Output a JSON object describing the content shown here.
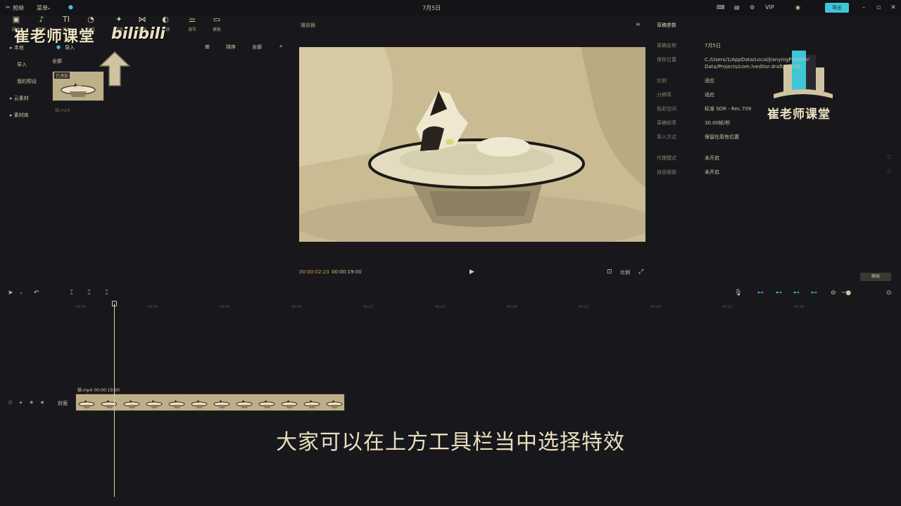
{
  "titlebar": {
    "app_name": "剪映",
    "menu": "菜单",
    "center_title": "7月5日",
    "export": "导出"
  },
  "toolbar": {
    "tools": [
      {
        "label": "媒体",
        "icon": "media-icon"
      },
      {
        "label": "音频",
        "icon": "audio-icon"
      },
      {
        "label": "文本",
        "icon": "text-icon"
      },
      {
        "label": "贴纸",
        "icon": "sticker-icon"
      },
      {
        "label": "特效",
        "icon": "effects-icon"
      },
      {
        "label": "转场",
        "icon": "transition-icon"
      },
      {
        "label": "滤镜",
        "icon": "filter-icon"
      },
      {
        "label": "调节",
        "icon": "adjust-icon"
      },
      {
        "label": "模板",
        "icon": "template-icon"
      }
    ]
  },
  "watermark": {
    "left": "崔老师课堂",
    "bili": "bilibili",
    "right": "崔老师课堂"
  },
  "sidebar": {
    "items": [
      {
        "label": "▸ 本地"
      },
      {
        "label": "导入"
      },
      {
        "label": "我的预设"
      },
      {
        "label": "▸ 云素材"
      },
      {
        "label": "▸ 素材库"
      }
    ]
  },
  "media": {
    "import_label": "导入",
    "filter_all": "全部",
    "sort_label": "排序",
    "all_label": "全部",
    "thumb_tag": "已添加",
    "filename": "猫.mp4"
  },
  "player": {
    "title": "播放器",
    "current_time": "00:00:02:23",
    "total_time": "00:00:19:00",
    "ratio_label": "比例",
    "aspect_button": "原始"
  },
  "properties": {
    "title": "草稿参数",
    "rows": [
      {
        "key": "草稿名称",
        "value": "7月5日"
      },
      {
        "key": "保存位置",
        "value": "C:/Users/1/AppData/Local/JianyingPro/User Data/Projects/com.lveditor.draft/7月5日"
      },
      {
        "key": "比例",
        "value": "适应"
      },
      {
        "key": "分辨率",
        "value": "适应"
      },
      {
        "key": "色彩空间",
        "value": "标准 SDR - Rec.709"
      },
      {
        "key": "草稿帧率",
        "value": "30.00帧/秒"
      },
      {
        "key": "导入方式",
        "value": "保留在原有位置"
      },
      {
        "key": "代理模式",
        "value": "未开启"
      },
      {
        "key": "自由层级",
        "value": "未开启"
      }
    ]
  },
  "timeline": {
    "ticks": [
      "00:00",
      "00:03",
      "00:06",
      "00:09",
      "00:12",
      "00:15",
      "00:18",
      "00:21",
      "00:24",
      "00:27",
      "00:30"
    ],
    "clip_label": "猫.mp4  00:00:19:00",
    "cover_label": "封面",
    "frame_count": 12
  },
  "subtitle": "大家可以在上方工具栏当中选择特效",
  "colors": {
    "background": "#18171c",
    "accent": "#3fc6d6",
    "text": "#d8cfb0"
  }
}
